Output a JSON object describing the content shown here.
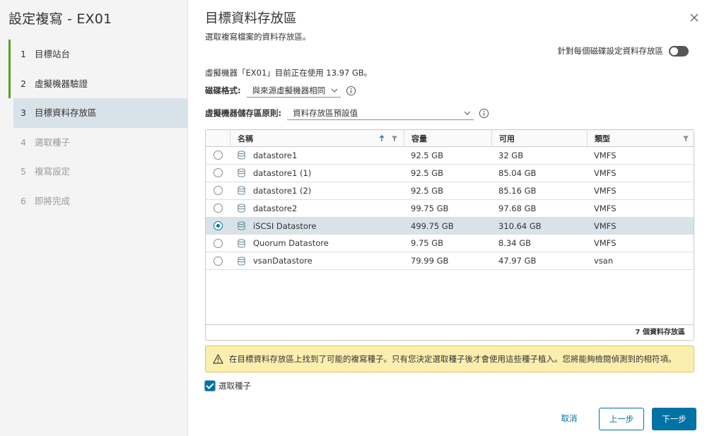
{
  "wizard": {
    "title": "設定複寫 - EX01",
    "steps": [
      {
        "num": "1",
        "label": "目標站台",
        "state": "done"
      },
      {
        "num": "2",
        "label": "虛擬機器驗證",
        "state": "done"
      },
      {
        "num": "3",
        "label": "目標資料存放區",
        "state": "active"
      },
      {
        "num": "4",
        "label": "選取種子",
        "state": "future"
      },
      {
        "num": "5",
        "label": "複寫設定",
        "state": "future"
      },
      {
        "num": "6",
        "label": "即將完成",
        "state": "future"
      }
    ]
  },
  "page": {
    "title": "目標資料存放區",
    "subtitle": "選取複寫檔案的資料存放區。",
    "toggle_label": "針對每個磁碟設定資料存放區",
    "toggle_on": false,
    "usage_text": "虛擬機器「EX01」目前正在使用 13.97 GB。",
    "disk_format_label": "磁碟格式:",
    "disk_format_value": "與來源虛擬機器相同",
    "storage_policy_label": "虛擬機器儲存區原則:",
    "storage_policy_value": "資料存放區預設值"
  },
  "grid": {
    "columns": {
      "name": "名稱",
      "capacity": "容量",
      "free": "可用",
      "type": "類型"
    },
    "rows": [
      {
        "name": "datastore1",
        "capacity": "92.5 GB",
        "free": "32 GB",
        "type": "VMFS",
        "selected": false
      },
      {
        "name": "datastore1 (1)",
        "capacity": "92.5 GB",
        "free": "85.04 GB",
        "type": "VMFS",
        "selected": false
      },
      {
        "name": "datastore1 (2)",
        "capacity": "92.5 GB",
        "free": "85.16 GB",
        "type": "VMFS",
        "selected": false
      },
      {
        "name": "datastore2",
        "capacity": "99.75 GB",
        "free": "97.68 GB",
        "type": "VMFS",
        "selected": false
      },
      {
        "name": "iSCSI Datastore",
        "capacity": "499.75 GB",
        "free": "310.64 GB",
        "type": "VMFS",
        "selected": true
      },
      {
        "name": "Quorum Datastore",
        "capacity": "9.75 GB",
        "free": "8.34 GB",
        "type": "VMFS",
        "selected": false
      },
      {
        "name": "vsanDatastore",
        "capacity": "79.99 GB",
        "free": "47.97 GB",
        "type": "vsan",
        "selected": false
      }
    ],
    "footer": "7 個資料存放區"
  },
  "alert": {
    "text": "在目標資料存放區上找到了可能的複寫種子。只有您決定選取種子後才會使用這些種子植入。您將能夠檢閱偵測到的相符項。"
  },
  "seed_checkbox": {
    "label": "選取種子",
    "checked": true
  },
  "buttons": {
    "cancel": "取消",
    "back": "上一步",
    "next": "下一步"
  },
  "colors": {
    "accent": "#0072a3",
    "done_step": "#5aa220",
    "selected_row": "#d8e3e9",
    "alert_bg": "#fbefb0"
  }
}
